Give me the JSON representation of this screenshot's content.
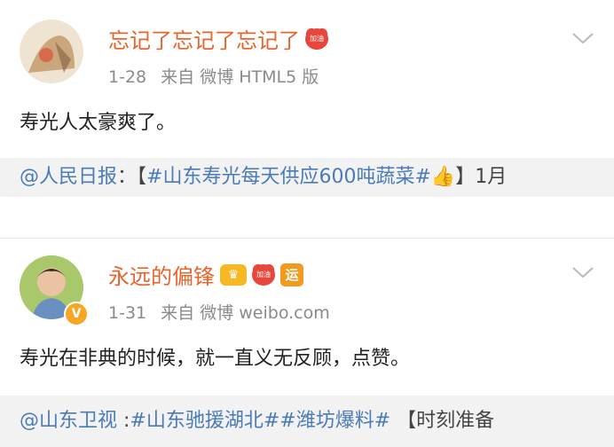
{
  "posts": [
    {
      "username": "忘记了忘记了忘记了",
      "badge_text": "加油",
      "meta": {
        "date": "1-28",
        "source": "来自 微博 HTML5 版"
      },
      "content": "寿光人太豪爽了。",
      "repost": {
        "at": "@人民日报",
        "sep": "：【",
        "topic": "#山东寿光每天供应600吨蔬菜#",
        "emoji": "👍",
        "tail": "】1月"
      }
    },
    {
      "username": "永远的偏锋",
      "badge_text": "加油",
      "yun_text": "运",
      "vip_mark": "V",
      "meta": {
        "date": "1-31",
        "source": "来自 微博 weibo.com"
      },
      "content": "寿光在非典的时候，就一直义无反顾，点赞。",
      "repost": {
        "at": "@山东卫视",
        "sep": " :",
        "topic1": "#山东驰援湖北#",
        "topic2": "#潍坊爆料#",
        "tail": " 【时刻准备"
      }
    }
  ],
  "colors": {
    "username": "#e8642c",
    "link": "#4a7bb7",
    "meta": "#8a8a8a",
    "badge": "#e8453c"
  }
}
